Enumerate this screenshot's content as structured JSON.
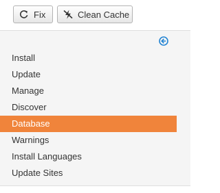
{
  "toolbar": {
    "fix_label": "Fix",
    "fix_icon": "refresh-icon",
    "clean_cache_label": "Clean Cache",
    "clean_cache_icon": "lightning-off-icon"
  },
  "sidebar": {
    "collapse_icon": "arrow-left-circle-icon",
    "accent_color": "#2384d3",
    "active_color": "#f0843b",
    "items": [
      {
        "label": "Install",
        "active": false
      },
      {
        "label": "Update",
        "active": false
      },
      {
        "label": "Manage",
        "active": false
      },
      {
        "label": "Discover",
        "active": false
      },
      {
        "label": "Database",
        "active": true
      },
      {
        "label": "Warnings",
        "active": false
      },
      {
        "label": "Install Languages",
        "active": false
      },
      {
        "label": "Update Sites",
        "active": false
      }
    ]
  }
}
